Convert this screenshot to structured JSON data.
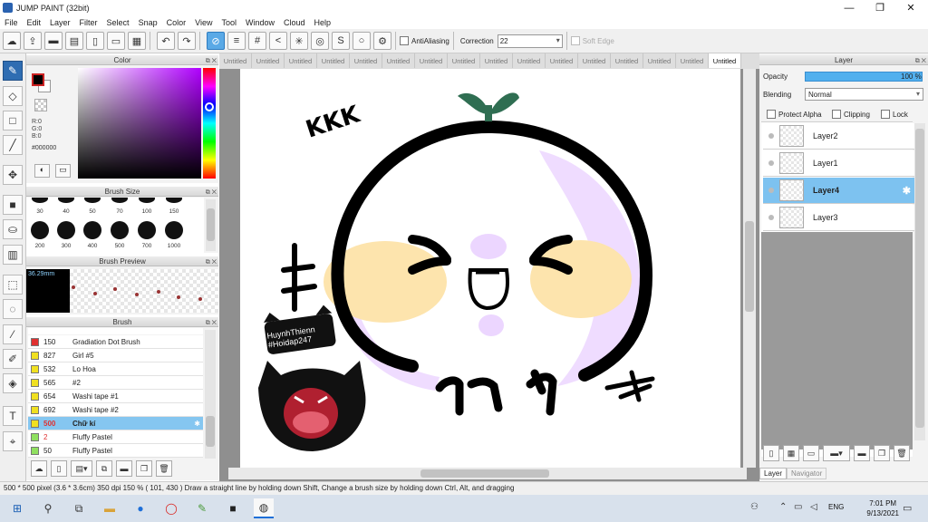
{
  "window": {
    "title": "JUMP PAINT (32bit)",
    "minimize": "—",
    "maximize": "❐",
    "close": "✕"
  },
  "menu": [
    "File",
    "Edit",
    "Layer",
    "Filter",
    "Select",
    "Snap",
    "Color",
    "View",
    "Tool",
    "Window",
    "Cloud",
    "Help"
  ],
  "toolbar": {
    "antialias_label": "AntiAliasing",
    "correction_label": "Correction",
    "correction_value": "22",
    "softedge_label": "Soft Edge"
  },
  "color_panel": {
    "title": "Color",
    "r": "R:0",
    "g": "G:0",
    "b": "B:0",
    "hex": "#000000",
    "fg": "#000000",
    "bg": "#ffffff"
  },
  "brush_size": {
    "title": "Brush Size",
    "row1": [
      "30",
      "40",
      "50",
      "70",
      "100",
      "150"
    ],
    "row2": [
      "200",
      "300",
      "400",
      "500",
      "700",
      "1000"
    ]
  },
  "brush_preview": {
    "title": "Brush Preview",
    "size_text": "36.29mm"
  },
  "brush_panel": {
    "title": "Brush",
    "items": [
      {
        "num": "150",
        "name": "Gradiation Dot Brush",
        "color": "#e03030"
      },
      {
        "num": "827",
        "name": "Girl #5",
        "color": "#f0e020"
      },
      {
        "num": "532",
        "name": "Lo Hoa",
        "color": "#f0e020"
      },
      {
        "num": "565",
        "name": "#2",
        "color": "#f0e020"
      },
      {
        "num": "654",
        "name": "Washi tape #1",
        "color": "#f0e020"
      },
      {
        "num": "692",
        "name": "Washi tape #2",
        "color": "#f0e020"
      },
      {
        "num": "500",
        "name": "Chữ kí",
        "color": "#f0e020"
      },
      {
        "num": "2",
        "name": "Fluffy Pastel",
        "color": "#90e060"
      },
      {
        "num": "50",
        "name": "Fluffy Pastel",
        "color": "#90e060"
      }
    ]
  },
  "tabs": [
    "Untitled",
    "Untitled",
    "Untitled",
    "Untitled",
    "Untitled",
    "Untitled",
    "Untitled",
    "Untitled",
    "Untitled",
    "Untitled",
    "Untitled",
    "Untitled",
    "Untitled",
    "Untitled",
    "Untitled",
    "Untitled"
  ],
  "canvas_text": {
    "kkk": "KKK",
    "watermark_line1": "HuynhThienn",
    "watermark_line2": "#Hoidap247"
  },
  "layer_panel": {
    "title": "Layer",
    "opacity_label": "Opacity",
    "opacity_value": "100 %",
    "blending_label": "Blending",
    "blending_value": "Normal",
    "protect_alpha": "Protect Alpha",
    "clipping": "Clipping",
    "lock": "Lock",
    "layers": [
      "Layer2",
      "Layer1",
      "Layer4",
      "Layer3"
    ],
    "selected": "Layer4",
    "tab_layer": "Layer",
    "tab_navigator": "Navigator"
  },
  "status": "500 * 500 pixel   (3.6 * 3.6cm)   350 dpi   150 %   ( 101, 430 )   Draw a straight line by holding down Shift, Change a brush size by holding down Ctrl, Alt, and dragging",
  "taskbar": {
    "lang": "ENG",
    "time": "7:01 PM",
    "date": "9/13/2021"
  }
}
